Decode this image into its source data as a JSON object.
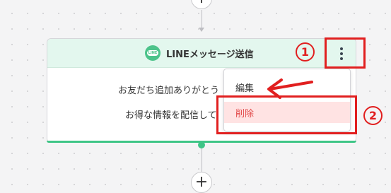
{
  "card": {
    "title": "LINEメッセージ送信",
    "logo_text": "LINE",
    "body_lines": [
      "お友だち追加ありがとう",
      "お得な情報を配信して"
    ]
  },
  "menu": {
    "edit_label": "編集",
    "delete_label": "削除"
  },
  "add_step_symbol": "+",
  "annotations": {
    "step1": "1",
    "step2": "2"
  },
  "colors": {
    "header_bg": "#e3f7ee",
    "accent_green": "#3fc587",
    "annotation_red": "#e11f1f",
    "delete_bg": "#ffe3e3",
    "delete_text": "#e24848"
  },
  "icons": {
    "kebab": "vertical-ellipsis-icon",
    "add": "plus-icon",
    "line_logo": "line-logo-icon"
  }
}
